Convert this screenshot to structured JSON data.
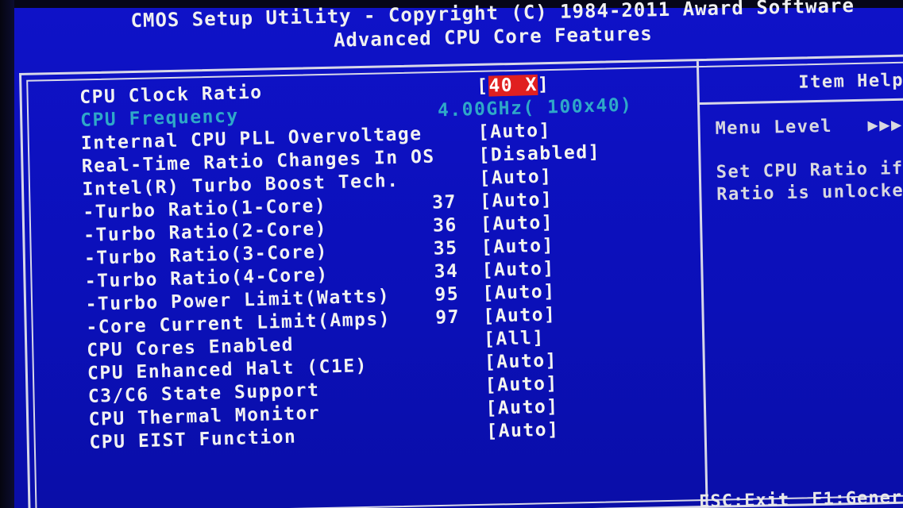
{
  "header": {
    "line1": "CMOS Setup Utility - Copyright (C) 1984-2011 Award Software",
    "line2": "Advanced CPU Core Features"
  },
  "settings": [
    {
      "label": "CPU Clock Ratio",
      "number": "",
      "value_pre": "[",
      "value_highlight": "40 X",
      "value_post": "]",
      "dim": false
    },
    {
      "label": "CPU Frequency",
      "number": "",
      "value": "4.00GHz( 100x40)",
      "dim": true
    },
    {
      "label": "Internal CPU PLL Overvoltage",
      "number": "",
      "value": "[Auto]",
      "dim": false
    },
    {
      "label": "Real-Time Ratio Changes In OS",
      "number": "",
      "value": "[Disabled]",
      "dim": false
    },
    {
      "label": "Intel(R) Turbo Boost Tech.",
      "number": "",
      "value": "[Auto]",
      "dim": false
    },
    {
      "label": "-Turbo Ratio(1-Core)",
      "number": "37",
      "value": "[Auto]",
      "dim": false
    },
    {
      "label": "-Turbo Ratio(2-Core)",
      "number": "36",
      "value": "[Auto]",
      "dim": false
    },
    {
      "label": "-Turbo Ratio(3-Core)",
      "number": "35",
      "value": "[Auto]",
      "dim": false
    },
    {
      "label": "-Turbo Ratio(4-Core)",
      "number": "34",
      "value": "[Auto]",
      "dim": false
    },
    {
      "label": "-Turbo Power Limit(Watts)",
      "number": "95",
      "value": "[Auto]",
      "dim": false
    },
    {
      "label": "-Core Current Limit(Amps)",
      "number": "97",
      "value": "[Auto]",
      "dim": false
    },
    {
      "label": "CPU Cores Enabled",
      "number": "",
      "value": "[All]",
      "dim": false
    },
    {
      "label": "CPU Enhanced Halt (C1E)",
      "number": "",
      "value": "[Auto]",
      "dim": false
    },
    {
      "label": "C3/C6 State Support",
      "number": "",
      "value": "[Auto]",
      "dim": false
    },
    {
      "label": "CPU Thermal Monitor",
      "number": "",
      "value": "[Auto]",
      "dim": false
    },
    {
      "label": "CPU EIST Function",
      "number": "",
      "value": "[Auto]",
      "dim": false
    }
  ],
  "help": {
    "title": "Item Help",
    "menu_level_label": "Menu Level",
    "menu_level_arrows": "▶▶▶",
    "desc_line1": "Set CPU Ratio if",
    "desc_line2": "Ratio is unlocke"
  },
  "footer": {
    "esc": "ESC:Exit",
    "f1": "F1:Gener"
  },
  "colors": {
    "background": "#0f12c8",
    "text": "#f2f2f2",
    "dim_text": "#2fa8c8",
    "highlight": "#e02020"
  }
}
